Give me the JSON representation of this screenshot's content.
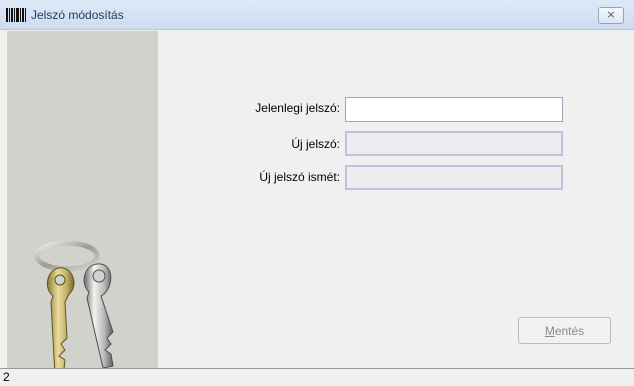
{
  "window": {
    "title": "Jelszó módosítás",
    "close_glyph": "⨯",
    "app_icon": "barcode-icon",
    "side_image": "keys-icon"
  },
  "form": {
    "current_password_label": "Jelenlegi jelszó:",
    "new_password_label": "Új jelszó:",
    "repeat_password_label": "Új jelszó ismét:",
    "current_password_value": "",
    "new_password_value": "",
    "repeat_password_value": ""
  },
  "actions": {
    "save_label_underlined": "M",
    "save_label_rest": "entés"
  },
  "statusbar": {
    "text": "2"
  },
  "colors": {
    "side_panel": "#d2d2cc",
    "titlebar": "#cddcef",
    "disabled_field": "#ededed"
  }
}
